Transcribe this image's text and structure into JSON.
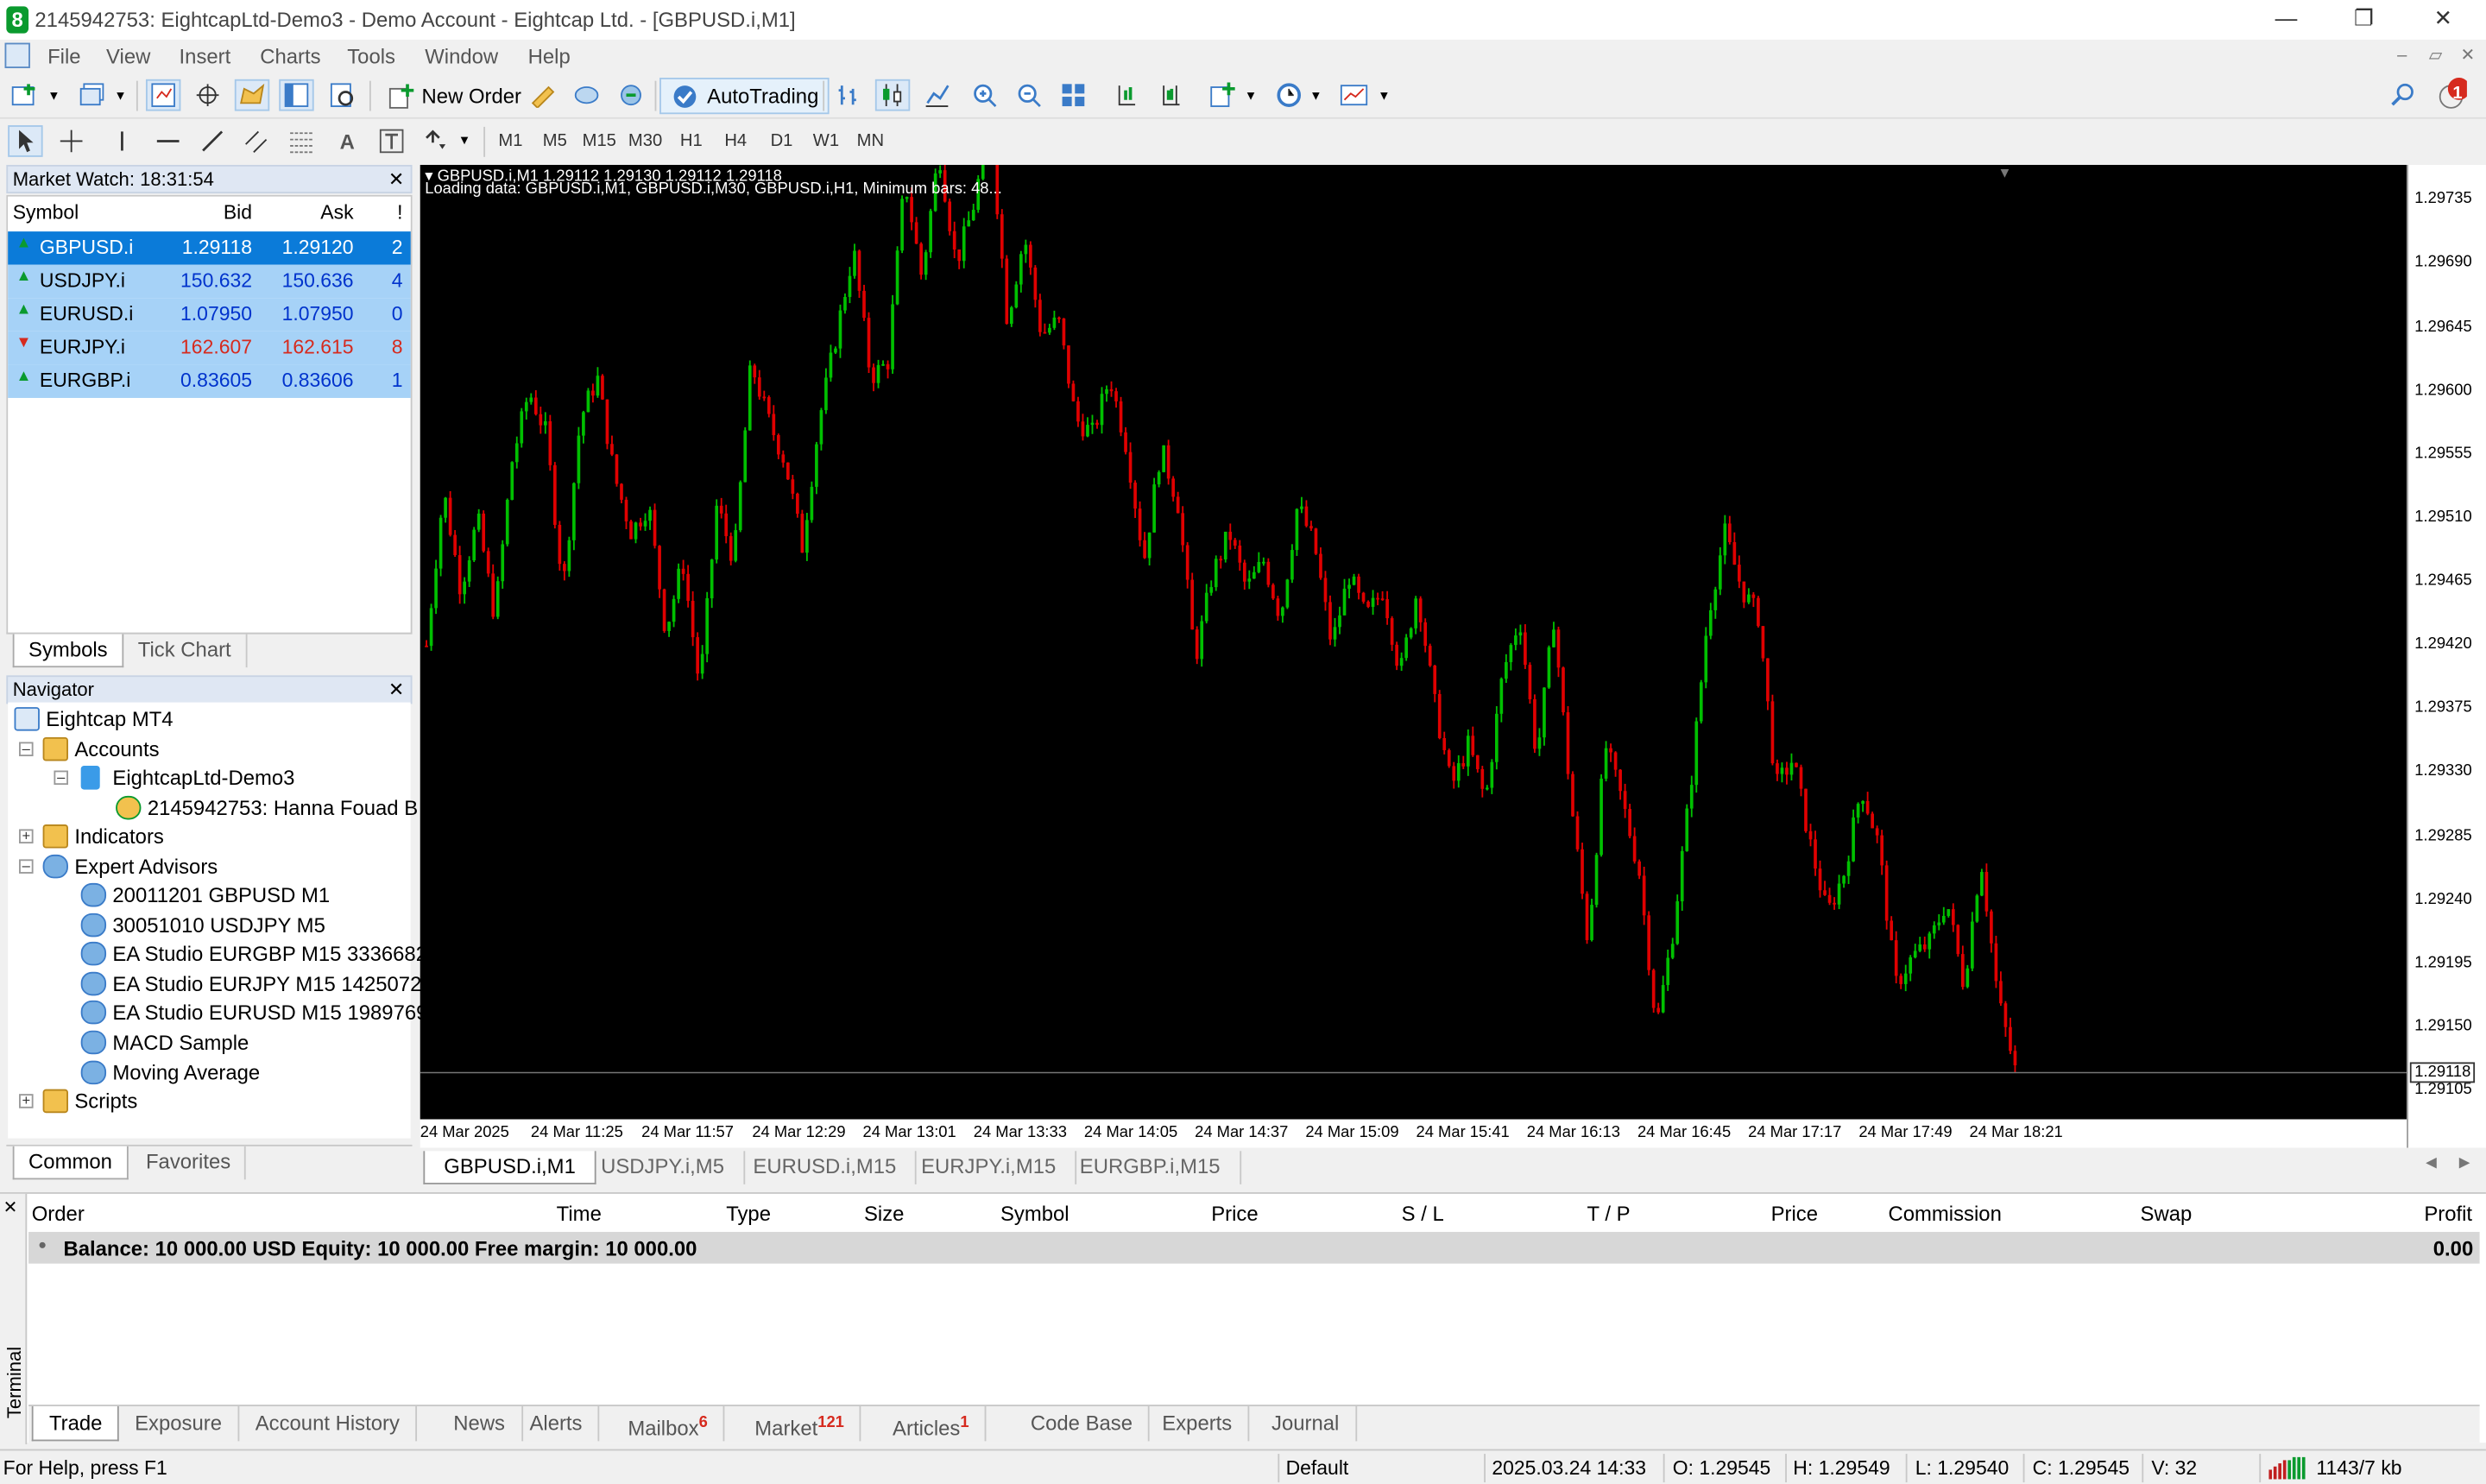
{
  "window": {
    "title": "2145942753: EightcapLtd-Demo3 - Demo Account - Eightcap Ltd. - [GBPUSD.i,M1]",
    "app_icon": "8"
  },
  "menu": [
    "File",
    "View",
    "Insert",
    "Charts",
    "Tools",
    "Window",
    "Help"
  ],
  "toolbar": {
    "new_order": "New Order",
    "autotrading": "AutoTrading",
    "notification_count": "1"
  },
  "timeframes": [
    "M1",
    "M5",
    "M15",
    "M30",
    "H1",
    "H4",
    "D1",
    "W1",
    "MN"
  ],
  "market_watch": {
    "title": "Market Watch: 18:31:54",
    "headers": {
      "symbol": "Symbol",
      "bid": "Bid",
      "ask": "Ask",
      "spread": "!"
    },
    "rows": [
      {
        "symbol": "GBPUSD.i",
        "bid": "1.29118",
        "ask": "1.29120",
        "spread": "2",
        "dir": "up",
        "color": "#ffffff"
      },
      {
        "symbol": "USDJPY.i",
        "bid": "150.632",
        "ask": "150.636",
        "spread": "4",
        "dir": "up",
        "color": "#0033cc"
      },
      {
        "symbol": "EURUSD.i",
        "bid": "1.07950",
        "ask": "1.07950",
        "spread": "0",
        "dir": "up",
        "color": "#0033cc"
      },
      {
        "symbol": "EURJPY.i",
        "bid": "162.607",
        "ask": "162.615",
        "spread": "8",
        "dir": "down",
        "color": "#d62a1e"
      },
      {
        "symbol": "EURGBP.i",
        "bid": "0.83605",
        "ask": "0.83606",
        "spread": "1",
        "dir": "up",
        "color": "#0033cc"
      }
    ],
    "tabs": [
      "Symbols",
      "Tick Chart"
    ]
  },
  "navigator": {
    "title": "Navigator",
    "root": "Eightcap MT4",
    "accounts": "Accounts",
    "account_server": "EightcapLtd-Demo3",
    "account_user": "2145942753: Hanna Fouad B",
    "indicators": "Indicators",
    "experts": "Expert Advisors",
    "ea_items": [
      "20011201 GBPUSD M1",
      "30051010 USDJPY M5",
      "EA Studio EURGBP M15 3336682",
      "EA Studio EURJPY M15 1425072",
      "EA Studio EURUSD M15 1989769",
      "MACD Sample",
      "Moving Average"
    ],
    "scripts": "Scripts",
    "tabs": [
      "Common",
      "Favorites"
    ]
  },
  "chart": {
    "header": "GBPUSD.i,M1  1.29112 1.29130 1.29112 1.29118",
    "loading": "Loading data: GBPUSD.i,M1, GBPUSD.i,M30, GBPUSD.i,H1, Minimum bars: 48...",
    "current_price": "1.29118",
    "bull_color": "#00c000",
    "bear_color": "#e00000"
  },
  "chart_data": {
    "type": "candlestick",
    "symbol": "GBPUSD.i",
    "timeframe": "M1",
    "ylim": [
      1.29085,
      1.2976
    ],
    "y_ticks": [
      "1.29735",
      "1.29690",
      "1.29645",
      "1.29600",
      "1.29555",
      "1.29510",
      "1.29465",
      "1.29420",
      "1.29375",
      "1.29330",
      "1.29285",
      "1.29240",
      "1.29195",
      "1.29150",
      "1.29105"
    ],
    "x_ticks": [
      "24 Mar 2025",
      "24 Mar 11:25",
      "24 Mar 11:57",
      "24 Mar 12:29",
      "24 Mar 13:01",
      "24 Mar 13:33",
      "24 Mar 14:05",
      "24 Mar 14:37",
      "24 Mar 15:09",
      "24 Mar 15:41",
      "24 Mar 16:13",
      "24 Mar 16:45",
      "24 Mar 17:17",
      "24 Mar 17:49",
      "24 Mar 18:21"
    ],
    "close_path": [
      1.2942,
      1.2953,
      1.2946,
      1.2951,
      1.2944,
      1.2955,
      1.296,
      1.2957,
      1.2946,
      1.2958,
      1.2961,
      1.2954,
      1.295,
      1.2952,
      1.2943,
      1.2948,
      1.2939,
      1.2952,
      1.2948,
      1.2962,
      1.2958,
      1.2955,
      1.2949,
      1.2958,
      1.2964,
      1.297,
      1.2961,
      1.2962,
      1.2975,
      1.2968,
      1.2977,
      1.2969,
      1.2973,
      1.2979,
      1.2965,
      1.2971,
      1.2964,
      1.2965,
      1.2958,
      1.2957,
      1.2961,
      1.2956,
      1.2948,
      1.2956,
      1.2952,
      1.2941,
      1.2947,
      1.295,
      1.2946,
      1.2948,
      1.2944,
      1.2952,
      1.2949,
      1.2942,
      1.2947,
      1.2944,
      1.2946,
      1.294,
      1.2946,
      1.2938,
      1.2932,
      1.2935,
      1.2931,
      1.294,
      1.2944,
      1.2934,
      1.2944,
      1.2931,
      1.2921,
      1.2935,
      1.2931,
      1.2926,
      1.2915,
      1.2922,
      1.2932,
      1.2944,
      1.295,
      1.2946,
      1.2944,
      1.2932,
      1.2934,
      1.2928,
      1.2923,
      1.2926,
      1.2932,
      1.2928,
      1.2918,
      1.292,
      1.2921,
      1.2924,
      1.2918,
      1.2927,
      1.2917,
      1.2912
    ],
    "last_price": 1.29118
  },
  "chart_tabs": [
    "GBPUSD.i,M1",
    "USDJPY.i,M5",
    "EURUSD.i,M15",
    "EURJPY.i,M15",
    "EURGBP.i,M15"
  ],
  "terminal": {
    "side_label": "Terminal",
    "columns": [
      "Order",
      "Time",
      "Type",
      "Size",
      "Symbol",
      "Price",
      "S / L",
      "T / P",
      "Price",
      "Commission",
      "Swap",
      "Profit"
    ],
    "balance_text": "Balance: 10 000.00 USD  Equity: 10 000.00  Free margin: 10 000.00",
    "balance_profit": "0.00",
    "tabs": [
      {
        "label": "Trade",
        "badge": ""
      },
      {
        "label": "Exposure",
        "badge": ""
      },
      {
        "label": "Account History",
        "badge": ""
      },
      {
        "label": "News",
        "badge": ""
      },
      {
        "label": "Alerts",
        "badge": ""
      },
      {
        "label": "Mailbox",
        "badge": "6"
      },
      {
        "label": "Market",
        "badge": "121"
      },
      {
        "label": "Articles",
        "badge": "1"
      },
      {
        "label": "Code Base",
        "badge": ""
      },
      {
        "label": "Experts",
        "badge": ""
      },
      {
        "label": "Journal",
        "badge": ""
      }
    ]
  },
  "status": {
    "help": "For Help, press F1",
    "profile": "Default",
    "datetime": "2025.03.24 14:33",
    "open": "O: 1.29545",
    "high": "H: 1.29549",
    "low": "L: 1.29540",
    "close": "C: 1.29545",
    "volume": "V: 32",
    "traffic": "1143/7 kb"
  }
}
